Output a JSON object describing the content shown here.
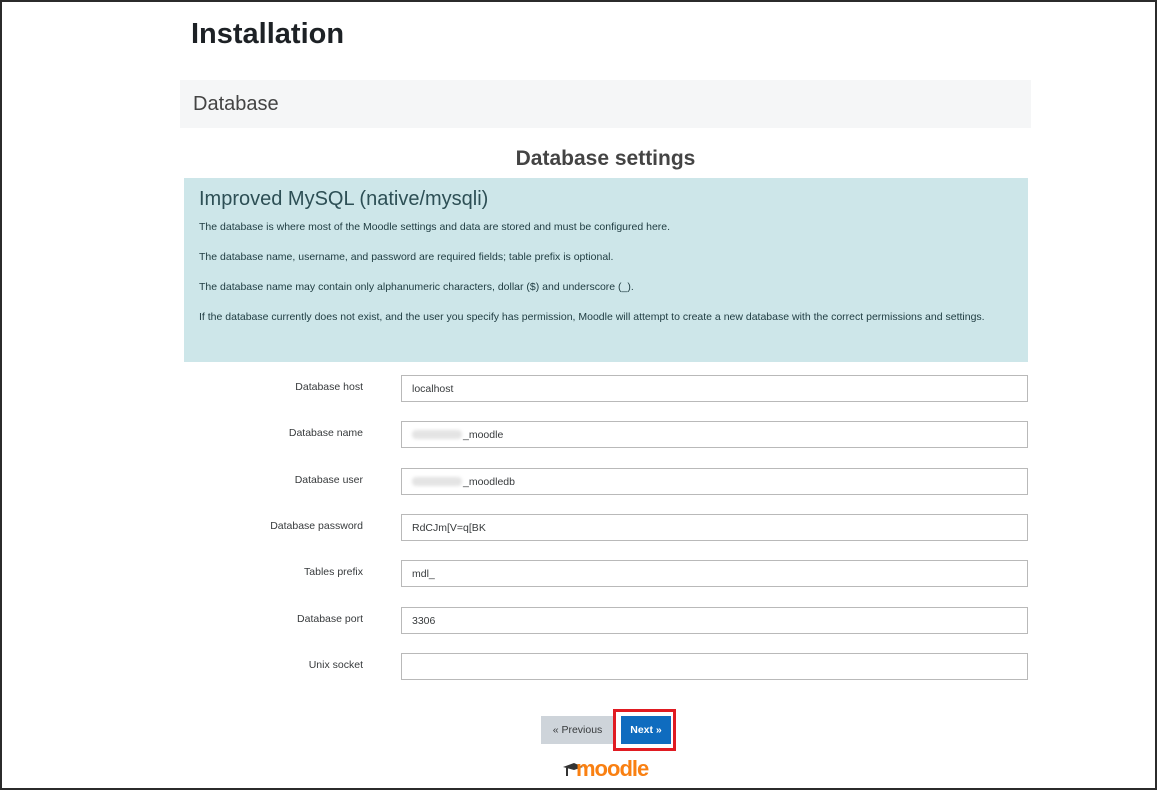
{
  "page": {
    "title": "Installation",
    "section": "Database",
    "settings_heading": "Database settings"
  },
  "info": {
    "heading": "Improved MySQL (native/mysqli)",
    "paragraphs": [
      "The database is where most of the Moodle settings and data are stored and must be configured here.",
      "The database name, username, and password are required fields; table prefix is optional.",
      "The database name may contain only alphanumeric characters, dollar ($) and underscore (_).",
      "If the database currently does not exist, and the user you specify has permission, Moodle will attempt to create a new database with the correct permissions and settings."
    ]
  },
  "form": {
    "db_host": {
      "label": "Database host",
      "value": "localhost"
    },
    "db_name": {
      "label": "Database name",
      "value": "_moodle"
    },
    "db_user": {
      "label": "Database user",
      "value": "_moodledb"
    },
    "db_password": {
      "label": "Database password",
      "value": "RdCJm[V=q[BK"
    },
    "tables_prefix": {
      "label": "Tables prefix",
      "value": "mdl_"
    },
    "db_port": {
      "label": "Database port",
      "value": "3306"
    },
    "unix_socket": {
      "label": "Unix socket",
      "value": ""
    }
  },
  "buttons": {
    "previous": "« Previous",
    "next": "Next »"
  },
  "logo": {
    "text": "moodle",
    "brand_color": "#f98012"
  },
  "colors": {
    "info_background": "#cde6e9",
    "primary_button": "#0f6cbf",
    "highlight_border": "#e01b22"
  }
}
